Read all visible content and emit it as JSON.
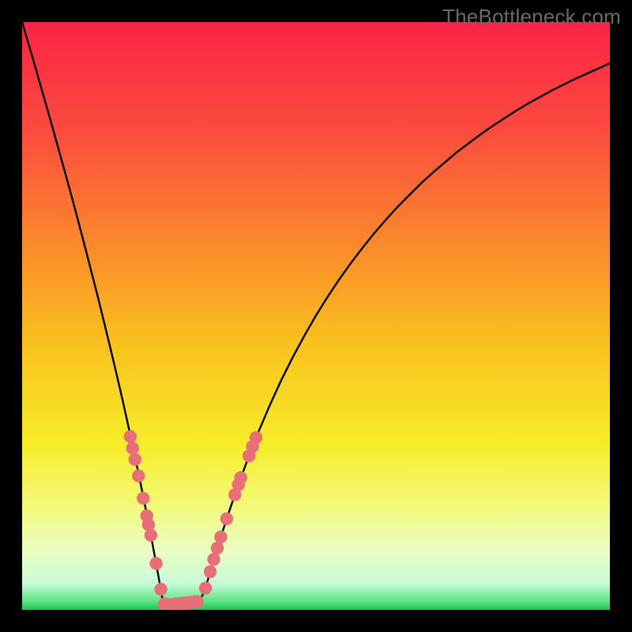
{
  "watermark": "TheBottleneck.com",
  "colors": {
    "frame": "#000000",
    "curve": "#000000",
    "marker": "#e86f77",
    "gradient_stops": [
      {
        "offset": 0.0,
        "color": "#fb2445"
      },
      {
        "offset": 0.18,
        "color": "#fb4a3f"
      },
      {
        "offset": 0.38,
        "color": "#fa8a2a"
      },
      {
        "offset": 0.55,
        "color": "#f9c21e"
      },
      {
        "offset": 0.72,
        "color": "#f6ed2a"
      },
      {
        "offset": 0.82,
        "color": "#f2f977"
      },
      {
        "offset": 0.9,
        "color": "#eafdc3"
      },
      {
        "offset": 0.955,
        "color": "#c7fbd9"
      },
      {
        "offset": 0.985,
        "color": "#5fe582"
      },
      {
        "offset": 1.0,
        "color": "#1fc253"
      }
    ]
  },
  "chart_data": {
    "type": "line",
    "title": "",
    "xlabel": "",
    "ylabel": "",
    "xlim": [
      0,
      100
    ],
    "ylim": [
      0,
      100
    ],
    "x": [
      0,
      1,
      2,
      3,
      4,
      5,
      6,
      7,
      8,
      9,
      10,
      11,
      12,
      13,
      14,
      15,
      16,
      17,
      18,
      19,
      20,
      21,
      22,
      23,
      24,
      25,
      26,
      27,
      28,
      29,
      30,
      31,
      32,
      33,
      34,
      35,
      36,
      37,
      38,
      39,
      40,
      42,
      44,
      46,
      48,
      50,
      52,
      54,
      56,
      58,
      60,
      62,
      64,
      66,
      68,
      70,
      72,
      74,
      76,
      78,
      80,
      82,
      84,
      86,
      88,
      90,
      92,
      94,
      96,
      98,
      100
    ],
    "y": [
      100,
      96.6,
      93.2,
      89.7,
      86.2,
      82.7,
      79.1,
      75.5,
      71.9,
      68.2,
      64.4,
      60.6,
      56.7,
      52.8,
      48.7,
      44.6,
      40.4,
      36.1,
      31.6,
      27.0,
      22.3,
      17.3,
      12.2,
      6.8,
      1.2,
      0.9,
      1.0,
      1.1,
      1.2,
      1.3,
      1.4,
      3.0,
      6.5,
      9.8,
      13.0,
      16.1,
      19.0,
      21.9,
      24.6,
      27.2,
      29.8,
      34.5,
      38.9,
      42.9,
      46.6,
      50.1,
      53.3,
      56.3,
      59.1,
      61.7,
      64.2,
      66.5,
      68.7,
      70.7,
      72.7,
      74.5,
      76.2,
      77.9,
      79.4,
      80.9,
      82.3,
      83.6,
      84.9,
      86.1,
      87.2,
      88.3,
      89.3,
      90.3,
      91.2,
      92.1,
      93.0
    ],
    "markers": [
      {
        "x": 18.4,
        "y": 29.5
      },
      {
        "x": 18.8,
        "y": 27.5
      },
      {
        "x": 19.2,
        "y": 25.6
      },
      {
        "x": 19.8,
        "y": 22.8
      },
      {
        "x": 20.6,
        "y": 19.0
      },
      {
        "x": 21.2,
        "y": 16.0
      },
      {
        "x": 21.5,
        "y": 14.5
      },
      {
        "x": 21.9,
        "y": 12.7
      },
      {
        "x": 22.8,
        "y": 7.9
      },
      {
        "x": 23.6,
        "y": 3.5
      },
      {
        "x": 24.2,
        "y": 1.0
      },
      {
        "x": 24.6,
        "y": 0.9
      },
      {
        "x": 25.0,
        "y": 0.9
      },
      {
        "x": 25.4,
        "y": 0.9
      },
      {
        "x": 25.8,
        "y": 0.9
      },
      {
        "x": 26.2,
        "y": 1.0
      },
      {
        "x": 26.6,
        "y": 1.0
      },
      {
        "x": 27.0,
        "y": 1.1
      },
      {
        "x": 27.4,
        "y": 1.1
      },
      {
        "x": 27.8,
        "y": 1.2
      },
      {
        "x": 28.2,
        "y": 1.2
      },
      {
        "x": 28.6,
        "y": 1.3
      },
      {
        "x": 29.0,
        "y": 1.3
      },
      {
        "x": 29.4,
        "y": 1.4
      },
      {
        "x": 29.8,
        "y": 1.4
      },
      {
        "x": 31.2,
        "y": 3.7
      },
      {
        "x": 32.0,
        "y": 6.5
      },
      {
        "x": 32.6,
        "y": 8.6
      },
      {
        "x": 33.2,
        "y": 10.5
      },
      {
        "x": 33.8,
        "y": 12.4
      },
      {
        "x": 34.8,
        "y": 15.5
      },
      {
        "x": 36.2,
        "y": 19.6
      },
      {
        "x": 36.8,
        "y": 21.3
      },
      {
        "x": 37.2,
        "y": 22.5
      },
      {
        "x": 38.6,
        "y": 26.2
      },
      {
        "x": 39.2,
        "y": 27.8
      },
      {
        "x": 39.8,
        "y": 29.3
      }
    ]
  }
}
